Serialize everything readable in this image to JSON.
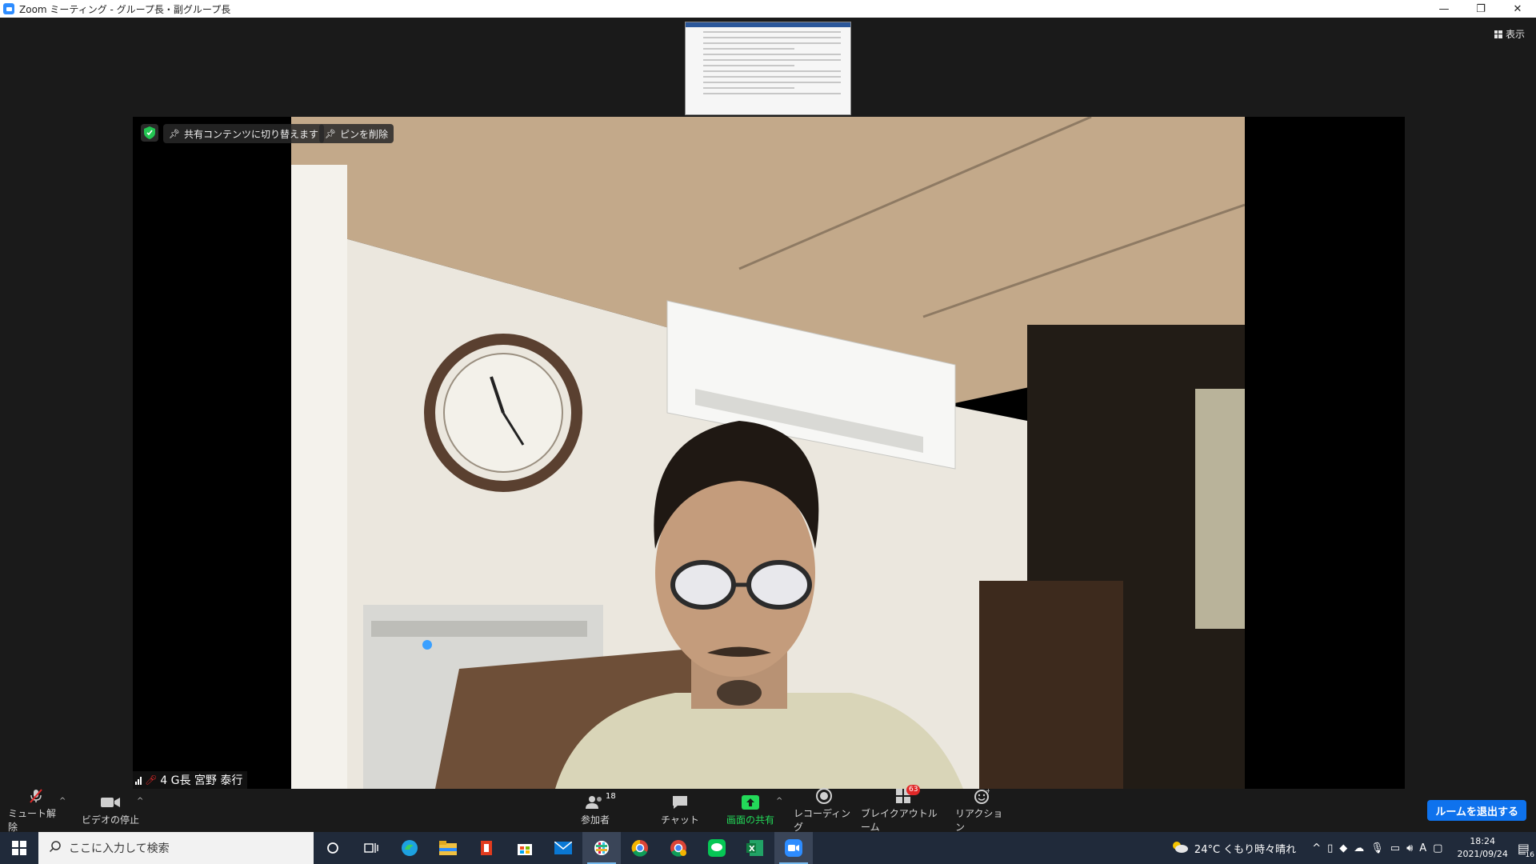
{
  "window": {
    "title": "Zoom ミーティング - グループ長・副グループ長",
    "controls": {
      "minimize": "—",
      "restore": "❐",
      "close": "✕"
    }
  },
  "meeting": {
    "view_label": "表示",
    "overlay": {
      "switch_to_shared": "共有コンテンツに切り替えます",
      "remove_pin": "ピンを削除"
    },
    "participant_name": "4 G長 宮野 泰行"
  },
  "toolbar": {
    "unmute": "ミュート解除",
    "stop_video": "ビデオの停止",
    "participants": "参加者",
    "participants_count": "18",
    "chat": "チャット",
    "share_screen": "画面の共有",
    "recording": "レコーディング",
    "breakout_rooms": "ブレイクアウトルーム",
    "breakout_count": "63",
    "reactions": "リアクション",
    "leave_room": "ルームを退出する",
    "colors": {
      "share": "#23d959",
      "leave": "#0e72ed",
      "badge": "#e02828"
    }
  },
  "taskbar": {
    "search_placeholder": "ここに入力して検索",
    "weather": "24°C くもり時々晴れ",
    "ime": "A",
    "time": "18:24",
    "date": "2021/09/24",
    "notifications": "16",
    "apps": [
      "cortana-icon",
      "task-view-icon",
      "edge-icon",
      "file-explorer-icon",
      "office-icon",
      "store-icon",
      "mail-icon",
      "slack-icon",
      "chrome-icon",
      "chrome-profile-icon",
      "line-icon",
      "excel-icon",
      "zoom-icon"
    ]
  }
}
